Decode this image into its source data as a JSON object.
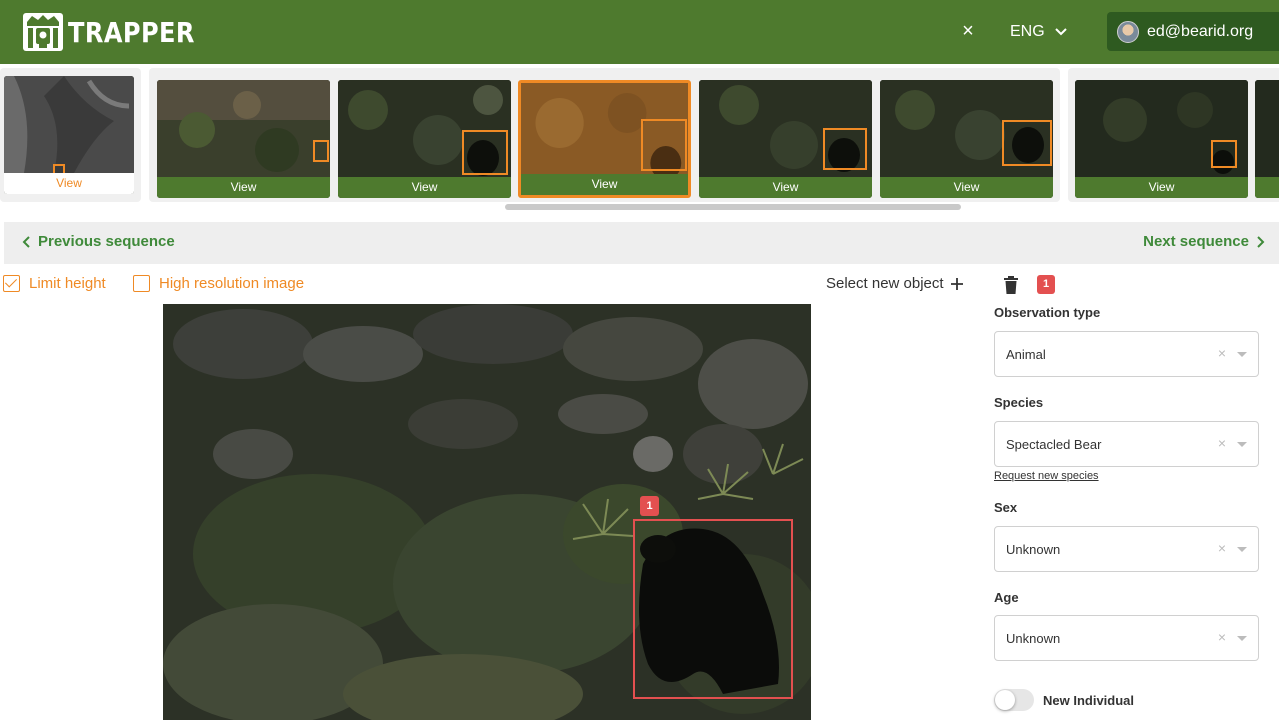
{
  "app": {
    "name": "TRAPPER"
  },
  "header": {
    "close_icon": "×",
    "language": "ENG",
    "user_email": "ed@bearid.org"
  },
  "thumbnails": [
    {
      "label": "View",
      "state": "first-partial"
    },
    {
      "label": "View"
    },
    {
      "label": "View"
    },
    {
      "label": "View",
      "state": "active"
    },
    {
      "label": "View"
    },
    {
      "label": "View"
    },
    {
      "label": "View"
    }
  ],
  "nav": {
    "previous": "Previous sequence",
    "next": "Next sequence"
  },
  "options": {
    "limit_height": {
      "label": "Limit height",
      "checked": true
    },
    "high_resolution": {
      "label": "High resolution image",
      "checked": false
    }
  },
  "toolbar": {
    "select_new_object": "Select new object",
    "object_count": "1"
  },
  "image": {
    "detection_badge": "1"
  },
  "form": {
    "observation_type": {
      "label": "Observation type",
      "value": "Animal"
    },
    "species": {
      "label": "Species",
      "value": "Spectacled Bear",
      "request_link": "Request new species"
    },
    "sex": {
      "label": "Sex",
      "value": "Unknown"
    },
    "age": {
      "label": "Age",
      "value": "Unknown"
    },
    "new_individual": {
      "label": "New Individual",
      "enabled": false
    }
  },
  "colors": {
    "header_green": "#4e7a2e",
    "accent_orange": "#ef8a25",
    "link_green": "#3f8a3a",
    "badge_red": "#e35050"
  }
}
